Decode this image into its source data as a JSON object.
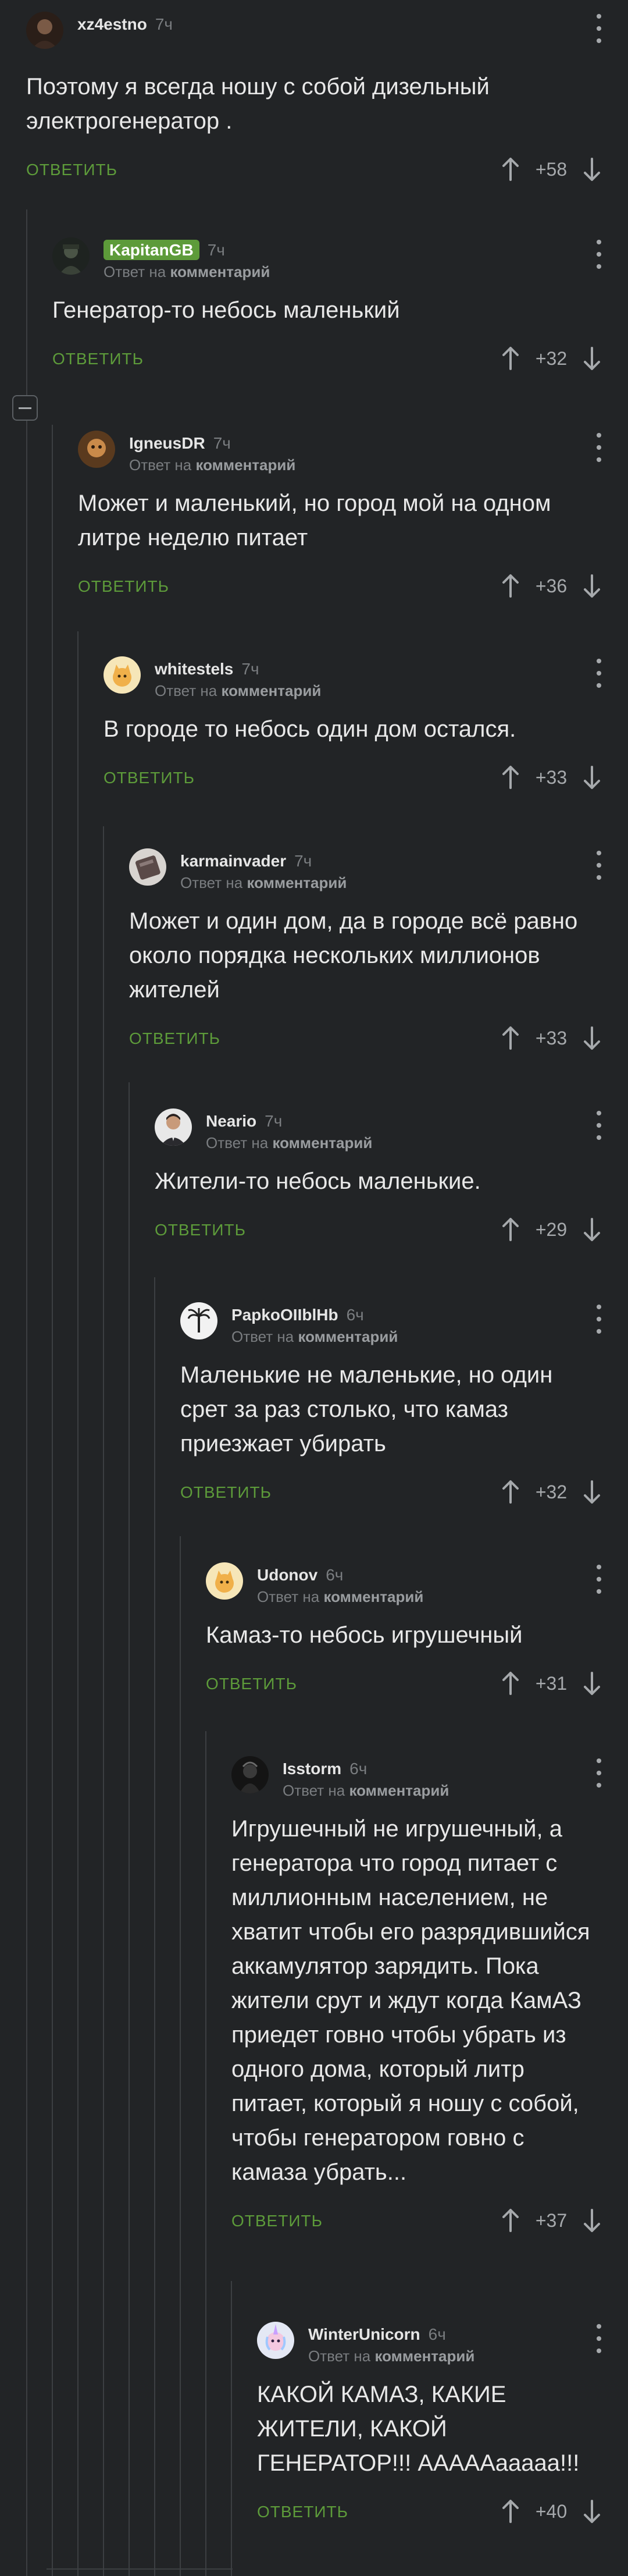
{
  "colors": {
    "background": "#222426",
    "accent": "#5d9b3a",
    "muted": "#7a7d80",
    "thread_line": "#3c3f42"
  },
  "labels": {
    "reply": "ОТВЕТИТЬ",
    "reply_to_prefix": "Ответ на",
    "reply_to_target": "комментарий"
  },
  "comments": [
    {
      "author": "xz4estno",
      "time": "7ч",
      "text": "Поэтому я всегда ношу с собой дизельный электрогенератор .",
      "rating": "+58",
      "is_reply": false,
      "avatar": "dark-portrait"
    },
    {
      "author": "KapitanGB",
      "time": "7ч",
      "text": "Генератор-то небось маленький",
      "rating": "+32",
      "is_reply": true,
      "badge": true,
      "avatar": "soldier"
    },
    {
      "author": "IgneusDR",
      "time": "7ч",
      "text": "Может и маленький, но город мой на одном литре неделю питает",
      "rating": "+36",
      "is_reply": true,
      "avatar": "warm-face"
    },
    {
      "author": "whitestels",
      "time": "7ч",
      "text": "В городе то небось один дом остался.",
      "rating": "+33",
      "is_reply": true,
      "avatar": "peach-cat"
    },
    {
      "author": "karmainvader",
      "time": "7ч",
      "text": "Может и один дом, да в городе всё равно около порядка нескольких миллионов жителей",
      "rating": "+33",
      "is_reply": true,
      "avatar": "brick"
    },
    {
      "author": "Neario",
      "time": "7ч",
      "text": "Жители-то небось маленькие.",
      "rating": "+29",
      "is_reply": true,
      "avatar": "suit-man"
    },
    {
      "author": "PapkoOIIblHb",
      "time": "6ч",
      "text": "Маленькие не маленькие, но один срет за раз столько, что камаз приезжает убирать",
      "rating": "+32",
      "is_reply": true,
      "avatar": "palm"
    },
    {
      "author": "Udonov",
      "time": "6ч",
      "text": "Камаз-то небось игрушечный",
      "rating": "+31",
      "is_reply": true,
      "avatar": "peach-cat"
    },
    {
      "author": "Isstorm",
      "time": "6ч",
      "text": "Игрушечный не игрушечный, а генератора что город питает с миллионным населением, не хватит чтобы его разрядившийся аккамулятор зарядить. Пока жители срут и ждут когда КамАЗ приедет говно чтобы убрать из одного дома, который литр питает, который я ношу с собой, чтобы генератором говно с камаза убрать...",
      "rating": "+37",
      "is_reply": true,
      "avatar": "dark-figure"
    },
    {
      "author": "WinterUnicorn",
      "time": "6ч",
      "text": "КАКОЙ КАМАЗ, КАКИЕ ЖИТЕЛИ, КАКОЙ ГЕНЕРАТОР!!! ААААAaaaaa!!!",
      "rating": "+40",
      "is_reply": true,
      "avatar": "unicorn"
    }
  ]
}
